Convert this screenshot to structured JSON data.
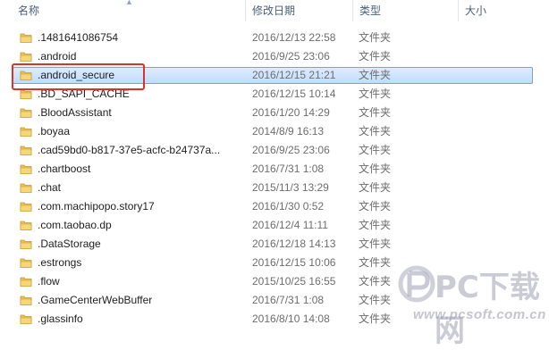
{
  "columns": {
    "name": "名称",
    "date": "修改日期",
    "type": "类型",
    "size": "大小"
  },
  "rows": [
    {
      "name": ".1481641086754",
      "date": "2016/12/13 22:58",
      "type": "文件夹"
    },
    {
      "name": ".android",
      "date": "2016/9/25 23:06",
      "type": "文件夹"
    },
    {
      "name": ".android_secure",
      "date": "2016/12/15 21:21",
      "type": "文件夹"
    },
    {
      "name": ".BD_SAPI_CACHE",
      "date": "2016/12/15 10:14",
      "type": "文件夹"
    },
    {
      "name": ".BloodAssistant",
      "date": "2016/1/20 14:29",
      "type": "文件夹"
    },
    {
      "name": ".boyaa",
      "date": "2014/8/9 16:13",
      "type": "文件夹"
    },
    {
      "name": ".cad59bd0-b817-37e5-acfc-b24737a...",
      "date": "2016/9/25 23:06",
      "type": "文件夹"
    },
    {
      "name": ".chartboost",
      "date": "2016/7/31 1:08",
      "type": "文件夹"
    },
    {
      "name": ".chat",
      "date": "2015/11/3 13:29",
      "type": "文件夹"
    },
    {
      "name": ".com.machipopo.story17",
      "date": "2016/1/30 0:52",
      "type": "文件夹"
    },
    {
      "name": ".com.taobao.dp",
      "date": "2016/12/4 11:11",
      "type": "文件夹"
    },
    {
      "name": ".DataStorage",
      "date": "2016/12/18 14:13",
      "type": "文件夹"
    },
    {
      "name": ".estrongs",
      "date": "2016/12/15 10:06",
      "type": "文件夹"
    },
    {
      "name": ".flow",
      "date": "2015/10/25 16:55",
      "type": "文件夹"
    },
    {
      "name": ".GameCenterWebBuffer",
      "date": "2016/7/31 1:08",
      "type": "文件夹"
    },
    {
      "name": ".glassinfo",
      "date": "2016/8/10 14:08",
      "type": "文件夹"
    }
  ],
  "selected_index": 2,
  "watermark": {
    "logo_text": "PC下载网",
    "url": "www.pcsoft.com.cn"
  },
  "colors": {
    "selection": "#c2dcfd",
    "highlight_border": "#d9342b",
    "folder": "#e8c15a"
  },
  "icons": {
    "row_icon": "folder-icon",
    "sort": "sort-up-icon"
  }
}
